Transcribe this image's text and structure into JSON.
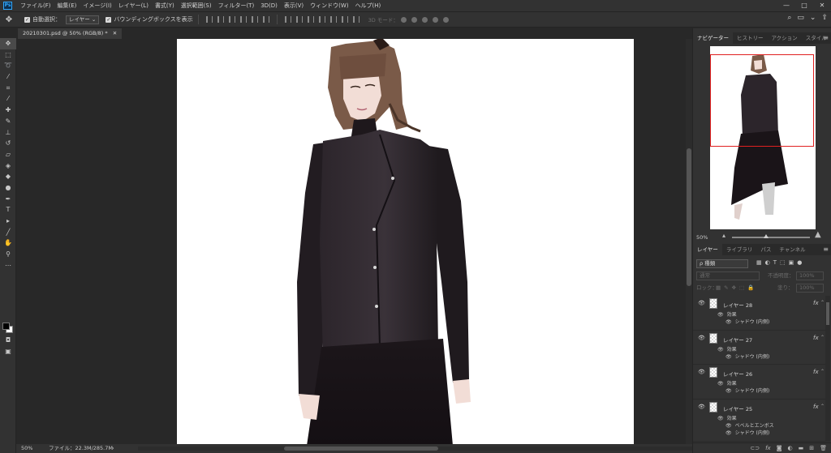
{
  "app": {
    "logo": "Ps",
    "menu": [
      "ファイル(F)",
      "編集(E)",
      "イメージ(I)",
      "レイヤー(L)",
      "書式(Y)",
      "選択範囲(S)",
      "フィルター(T)",
      "3D(D)",
      "表示(V)",
      "ウィンドウ(W)",
      "ヘルプ(H)"
    ],
    "window_controls": {
      "minimize": "—",
      "maximize": "□",
      "close": "✕"
    }
  },
  "options_bar": {
    "auto_select_label": "自動選択：",
    "auto_select_checked": true,
    "auto_select_target": "レイヤー",
    "bounding_box_label": "バウンディングボックスを表示",
    "bounding_box_checked": true,
    "mode_3d_label": "3D モード："
  },
  "document": {
    "tab_title": "20210301.psd @ 50% (RGB/8) *",
    "tab_close": "✕"
  },
  "status": {
    "zoom": "50%",
    "file_info": "ファイル：22.3M/285.7M",
    "arrow": "›"
  },
  "navigator_panel": {
    "tabs": [
      "ナビゲーター",
      "ヒストリー",
      "アクション",
      "スタイル"
    ],
    "active_tab": 0,
    "zoom": "50%",
    "zoom_level": 0.5,
    "menu_icon": "≡"
  },
  "layers_panel": {
    "tabs": [
      "レイヤー",
      "ライブラリ",
      "パス",
      "チャンネル"
    ],
    "active_tab": 0,
    "filter_kind": "ρ 種類",
    "blend_mode": "通常",
    "opacity_label": "不透明度：",
    "opacity_value": "100%",
    "lock_label": "ロック：",
    "fill_label": "塗り：",
    "fill_value": "100%",
    "layers": [
      {
        "name": "レイヤー 28",
        "effects_label": "効果",
        "effects": [
          "シャドウ (内側)"
        ]
      },
      {
        "name": "レイヤー 27",
        "effects_label": "効果",
        "effects": [
          "シャドウ (内側)"
        ]
      },
      {
        "name": "レイヤー 26",
        "effects_label": "効果",
        "effects": [
          "シャドウ (内側)"
        ]
      },
      {
        "name": "レイヤー 25",
        "effects_label": "効果",
        "effects": [
          "ベベルとエンボス",
          "シャドウ (内側)"
        ]
      }
    ],
    "fx_label": "fx",
    "bottom_icons": [
      "link-icon",
      "fx-icon",
      "mask-icon",
      "adjustment-icon",
      "group-icon",
      "new-layer-icon",
      "trash-icon"
    ]
  },
  "tools": [
    "move-icon",
    "marquee-icon",
    "lasso-icon",
    "magic-wand-icon",
    "crop-icon",
    "eyedropper-icon",
    "healing-icon",
    "brush-icon",
    "clone-stamp-icon",
    "history-brush-icon",
    "eraser-icon",
    "gradient-icon",
    "blur-icon",
    "dodge-icon",
    "pen-icon",
    "type-icon",
    "path-select-icon",
    "line-icon",
    "hand-icon",
    "zoom-icon",
    "more-icon"
  ],
  "type_tool_glyph": "T",
  "colors": {
    "accent_blue": "#31a8ff",
    "navigator_frame": "#e02020",
    "jacket": "#2a2429",
    "skirt": "#1a1418",
    "hair": "#7a5a48",
    "skin": "#f2ddd6"
  }
}
